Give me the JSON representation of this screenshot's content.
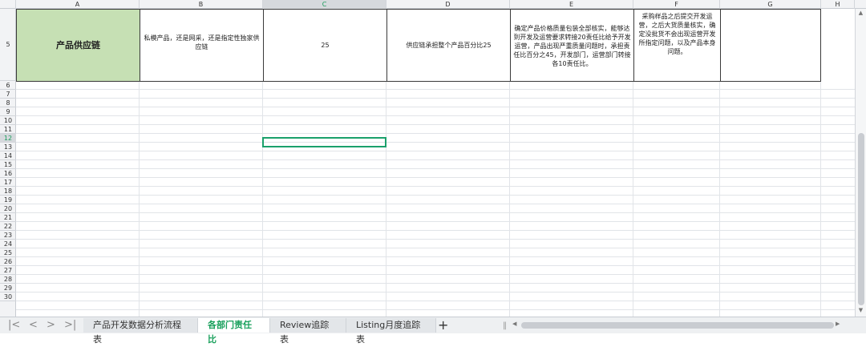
{
  "columns": [
    "A",
    "B",
    "C",
    "D",
    "E",
    "F",
    "G",
    "H"
  ],
  "selected_column": "C",
  "rows": [
    "5",
    "6",
    "7",
    "8",
    "9",
    "10",
    "11",
    "12",
    "13",
    "14",
    "15",
    "16",
    "17",
    "18",
    "19",
    "20",
    "21",
    "22",
    "23",
    "24",
    "25",
    "26",
    "27",
    "28",
    "29",
    "30"
  ],
  "selected_row": "12",
  "row5": {
    "a": "产品供应链",
    "b": "私模产品，还是网采，还是指定性独家供应链",
    "c": "25",
    "d": "供应链承担整个产品百分比25",
    "e": "确定产品价格质量包装全部核实，能够达到开发及运营要求转接20责任比给予开发运营，产品出现严重质量问题时，承担责任比百分之45，开发部门，运营部门转接各10责任比。",
    "f": "采购样品之后提交开发运营，之后大货质量核实，确定没批货不会出现运营开发所指定问题，以及产品本身问题。",
    "g": ""
  },
  "tabs": [
    {
      "label": "产品开发数据分析流程表",
      "active": false
    },
    {
      "label": "各部门责任比",
      "active": true
    },
    {
      "label": "Review追踪表",
      "active": false
    },
    {
      "label": "Listing月度追踪表",
      "active": false
    }
  ],
  "icons": {
    "first": "|<",
    "prev": "<",
    "next": ">",
    "last": ">|",
    "add": "+",
    "up": "▲",
    "down": "▼",
    "left": "◀",
    "right": "▶"
  },
  "colors": {
    "accent": "#19a05c",
    "a_cell": "#c6e0b4"
  }
}
